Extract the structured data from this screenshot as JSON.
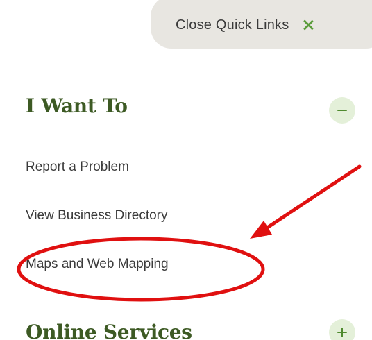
{
  "quick_links": {
    "close_label": "Close Quick Links",
    "close_icon": "close-x-icon"
  },
  "section": {
    "heading": "I Want To",
    "toggle_state": "expanded",
    "links": [
      {
        "label": "Report a Problem"
      },
      {
        "label": "View Business Directory"
      },
      {
        "label": "Maps and Web Mapping"
      }
    ]
  },
  "next_section": {
    "heading": "Online Services",
    "toggle_state": "collapsed"
  },
  "annotation": {
    "color": "#e01010",
    "highlighted_item": "Maps and Web Mapping"
  },
  "colors": {
    "heading_green": "#3d5a24",
    "accent_green": "#5a9c3a",
    "pill_bg": "#e8e6e1",
    "toggle_bg": "#e4f0d9"
  }
}
